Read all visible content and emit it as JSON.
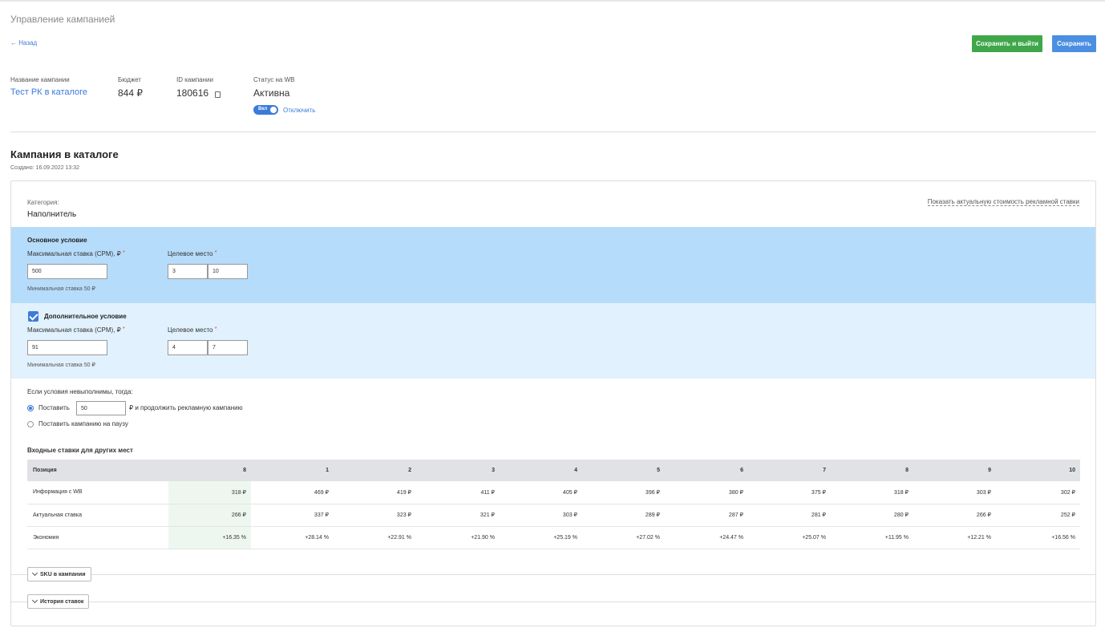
{
  "page": {
    "title": "Управление кампанией",
    "back": "← Назад"
  },
  "buttons": {
    "save_exit": "Сохранить и выйти",
    "save": "Сохранить"
  },
  "info": {
    "name_label": "Название кампании",
    "name_value": "Тест РК в каталоге",
    "budget_label": "Бюджет",
    "budget_value": "844 ₽",
    "id_label": "ID кампании",
    "id_value": "180616",
    "status_label": "Статус на WB",
    "status_value": "Активна",
    "toggle_label": "Вкл",
    "toggle_action": "Отключить"
  },
  "section": {
    "title": "Кампания в каталоге",
    "created": "Создано: 16.09.2022 13:32"
  },
  "category": {
    "label": "Категория:",
    "value": "Наполнитель",
    "show_price": "Показать актуальную стоимость рекламной ставки"
  },
  "main_condition": {
    "title": "Основное условие",
    "max_bid_label": "Максимальная ставка (CPM), ₽",
    "max_bid_value": "500",
    "target_label": "Целевое место",
    "target_from": "3",
    "target_to": "10",
    "min_hint": "Минимальная ставка 50 ₽"
  },
  "extra_condition": {
    "title": "Дополнительное условие",
    "checked": true,
    "max_bid_label": "Максимальная ставка (CPM), ₽",
    "max_bid_value": "91",
    "target_label": "Целевое место",
    "target_from": "4",
    "target_to": "7",
    "min_hint": "Минимальная ставка 50 ₽"
  },
  "fallback": {
    "title": "Если условия невыполнимы, тогда:",
    "option1_prefix": "Поставить",
    "option1_value": "50",
    "option1_suffix": "₽ и продолжить рекламную кампанию",
    "option2": "Поставить кампанию на паузу",
    "selected": 1
  },
  "bids_table": {
    "title": "Входные ставки для других мест",
    "headers": [
      "Позиция",
      "8",
      "1",
      "2",
      "3",
      "4",
      "5",
      "6",
      "7",
      "8",
      "9",
      "10"
    ],
    "rows": [
      [
        "Информация с WB",
        "318 ₽",
        "469 ₽",
        "419 ₽",
        "411 ₽",
        "405 ₽",
        "396 ₽",
        "380 ₽",
        "375 ₽",
        "318 ₽",
        "303 ₽",
        "302 ₽"
      ],
      [
        "Актуальная ставка",
        "266 ₽",
        "337 ₽",
        "323 ₽",
        "321 ₽",
        "303 ₽",
        "289 ₽",
        "287 ₽",
        "281 ₽",
        "280 ₽",
        "266 ₽",
        "252 ₽"
      ],
      [
        "Экономия",
        "+16.35 %",
        "+28.14 %",
        "+22.91 %",
        "+21.90 %",
        "+25.19 %",
        "+27.02 %",
        "+24.47 %",
        "+25.07 %",
        "+11.95 %",
        "+12.21 %",
        "+16.56 %"
      ]
    ]
  },
  "accordions": {
    "sku": "SKU в кампании",
    "history": "История ставок"
  },
  "colors": {
    "accent": "#3b7bd9",
    "green": "#3fa74a",
    "main_bg": "#b6dcfb",
    "extra_bg": "#e1f1fd"
  }
}
